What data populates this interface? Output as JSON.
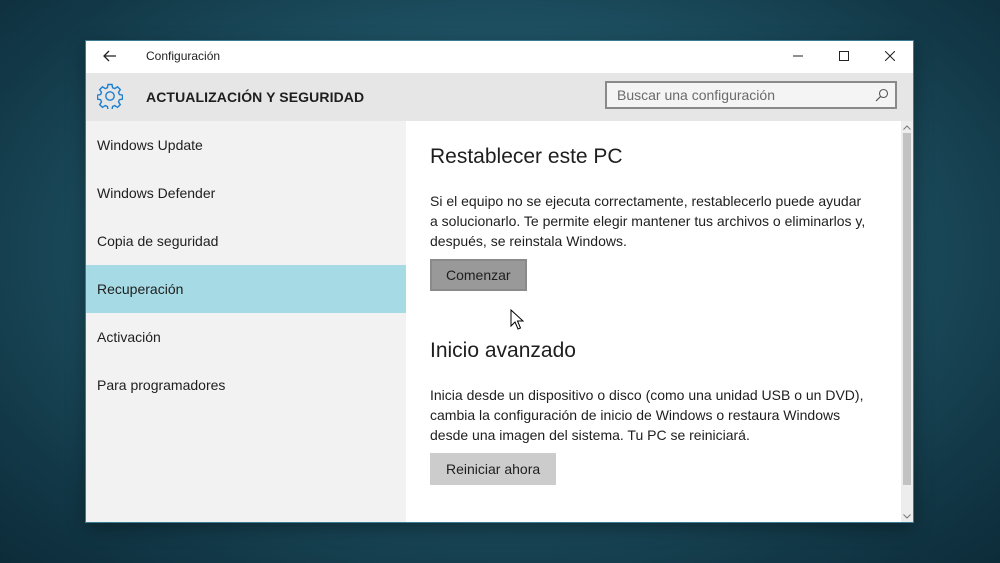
{
  "window": {
    "title": "Configuración"
  },
  "header": {
    "section_title": "ACTUALIZACIÓN Y SEGURIDAD",
    "search_placeholder": "Buscar una configuración"
  },
  "sidebar": {
    "items": [
      {
        "label": "Windows Update"
      },
      {
        "label": "Windows Defender"
      },
      {
        "label": "Copia de seguridad"
      },
      {
        "label": "Recuperación",
        "selected": true
      },
      {
        "label": "Activación"
      },
      {
        "label": "Para programadores"
      }
    ]
  },
  "main": {
    "reset": {
      "heading": "Restablecer este PC",
      "description": "Si el equipo no se ejecuta correctamente, restablecerlo puede ayudar a solucionarlo. Te permite elegir mantener tus archivos o eliminarlos y, después, se reinstala Windows.",
      "button_label": "Comenzar"
    },
    "advanced": {
      "heading": "Inicio avanzado",
      "description": "Inicia desde un dispositivo o disco (como una unidad USB o un DVD), cambia la configuración de inicio de Windows o restaura Windows desde una imagen del sistema. Tu PC se reiniciará.",
      "button_label": "Reiniciar ahora"
    }
  },
  "icons": {
    "back": "back-arrow-icon",
    "minimize": "minimize-icon",
    "maximize": "maximize-icon",
    "close": "close-icon",
    "section": "gear-icon",
    "search": "search-icon",
    "cursor": "mouse-pointer-icon"
  },
  "colors": {
    "accent": "#0078d7",
    "selected_nav": "#a6dbe6",
    "header_bg": "#e6e6e6",
    "sidebar_bg": "#f2f2f2",
    "button_bg": "#cccccc",
    "button_pressed_bg": "#999999"
  }
}
